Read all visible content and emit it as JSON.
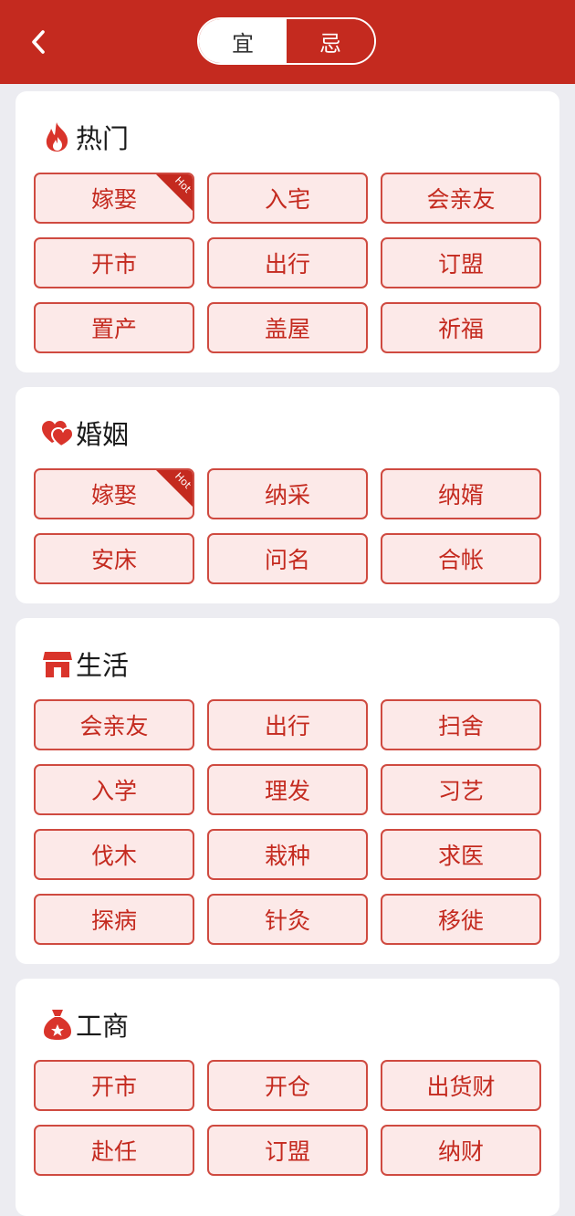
{
  "header": {
    "tabs": [
      {
        "label": "宜"
      },
      {
        "label": "忌"
      }
    ]
  },
  "colors": {
    "brand": "#c42a1f",
    "chip_bg": "#fce9e8",
    "chip_border": "#cf4a40",
    "page_bg": "#ececf1"
  },
  "hot_badge": "Hot",
  "sections": [
    {
      "title": "热门",
      "icon": "fire-icon",
      "items": [
        "嫁娶",
        "入宅",
        "会亲友",
        "开市",
        "出行",
        "订盟",
        "置产",
        "盖屋",
        "祈福"
      ]
    },
    {
      "title": "婚姻",
      "icon": "hearts-icon",
      "items": [
        "嫁娶",
        "纳采",
        "纳婿",
        "安床",
        "问名",
        "合帐"
      ]
    },
    {
      "title": "生活",
      "icon": "house-icon",
      "items": [
        "会亲友",
        "出行",
        "扫舍",
        "入学",
        "理发",
        "习艺",
        "伐木",
        "栽种",
        "求医",
        "探病",
        "针灸",
        "移徙"
      ]
    },
    {
      "title": "工商",
      "icon": "money-bag-icon",
      "items": [
        "开市",
        "开仓",
        "出货财",
        "赴任",
        "订盟",
        "纳财"
      ]
    }
  ]
}
